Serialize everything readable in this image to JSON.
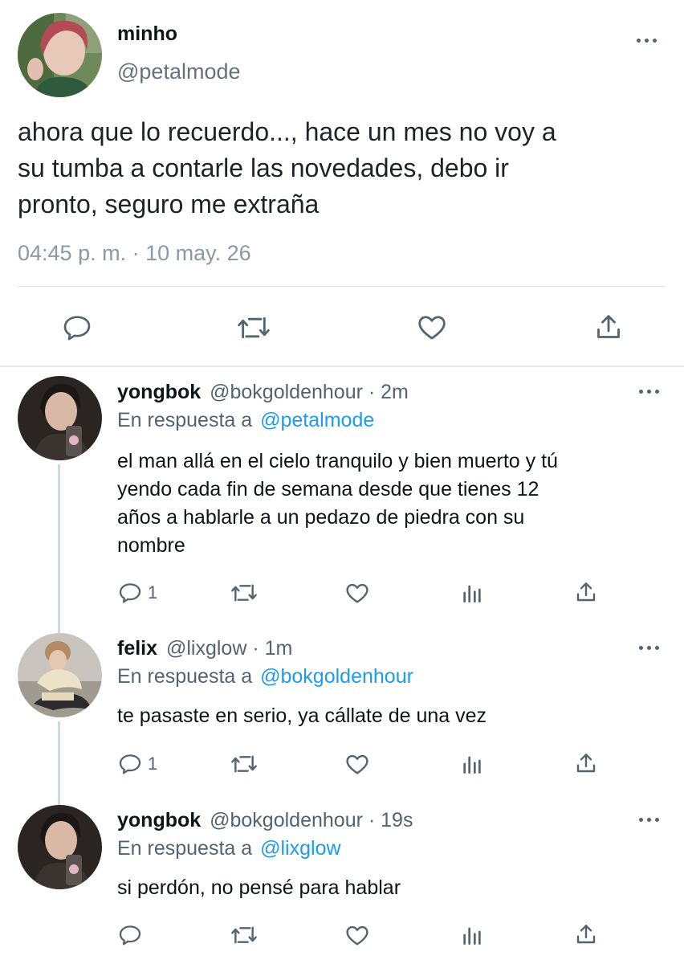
{
  "main_tweet": {
    "display_name": "minho",
    "handle": "@petalmode",
    "text_lines": [
      "ahora que lo recuerdo..., hace un mes no voy a",
      "su tumba a contarle las novedades, debo ir",
      "pronto, seguro me extraña"
    ],
    "timestamp": "04:45 p. m. · 10 may. 26"
  },
  "replies": [
    {
      "display_name": "yongbok",
      "handle_time": "@bokgoldenhour · 2m",
      "reply_prefix": "En respuesta a",
      "reply_to": "@petalmode",
      "text_lines": [
        "el man allá en el cielo tranquilo y bien muerto y tú",
        "yendo cada fin de semana desde que tienes 12",
        "años a hablarle a un pedazo de piedra con su",
        "nombre"
      ],
      "reply_count": "1"
    },
    {
      "display_name": "felix",
      "handle_time": "@lixglow · 1m",
      "reply_prefix": "En respuesta a",
      "reply_to": "@bokgoldenhour",
      "text_lines": [
        "te pasaste en serio, ya cállate de una vez"
      ],
      "reply_count": "1"
    },
    {
      "display_name": "yongbok",
      "handle_time": "@bokgoldenhour · 19s",
      "reply_prefix": "En respuesta a",
      "reply_to": "@lixglow",
      "text_lines": [
        "si perdón, no pensé para hablar"
      ],
      "reply_count": ""
    }
  ],
  "icons": [
    "reply-icon",
    "retweet-icon",
    "like-icon",
    "views-icon",
    "share-icon",
    "more-icon"
  ],
  "colors": {
    "accent": "#1d9bf0",
    "text": "#0f1419",
    "secondary": "#536471",
    "divider": "#e6e9ec"
  }
}
